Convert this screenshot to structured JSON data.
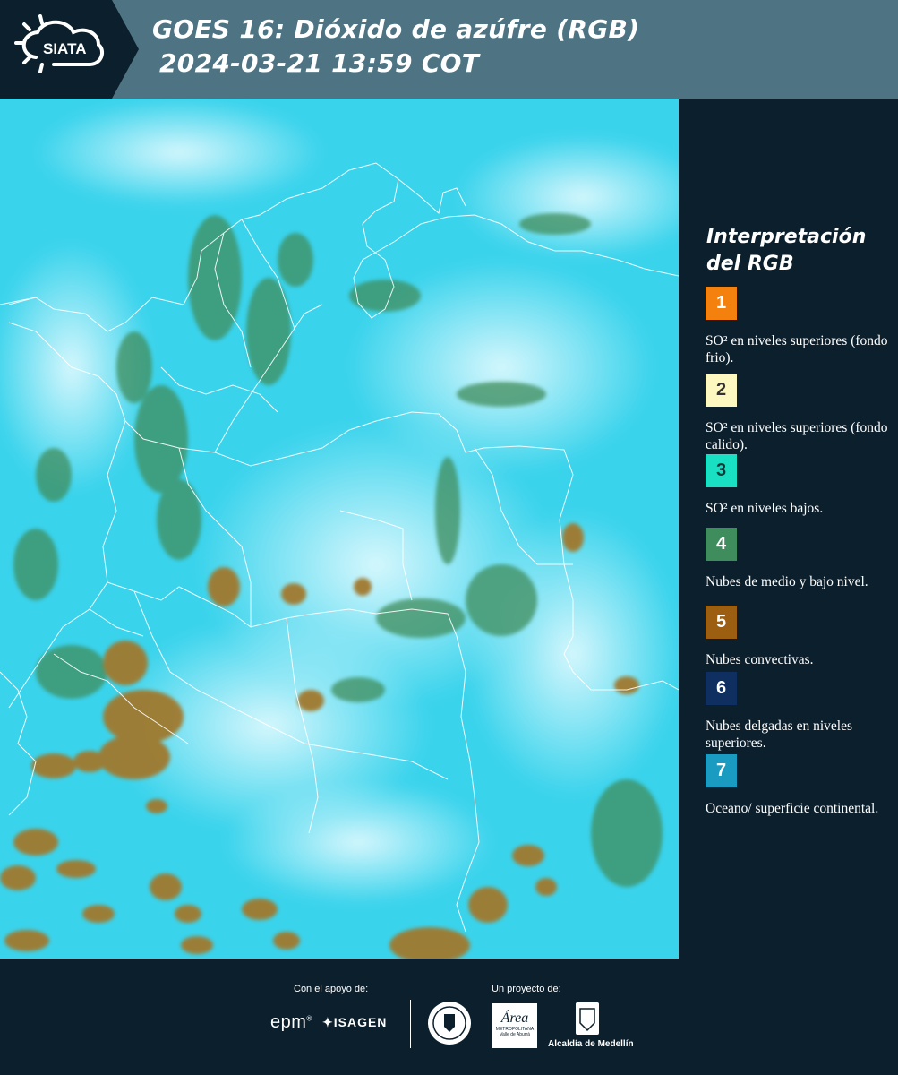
{
  "header": {
    "logo_text": "SIATA",
    "title_line1": "GOES 16: Dióxido de azúfre (RGB)",
    "title_line2": "2024-03-21 13:59 COT"
  },
  "legend": {
    "title_line1": "Interpretación",
    "title_line2": "del RGB",
    "items": [
      {
        "num": "1",
        "color": "#f4800e",
        "text_color": "#ffffff",
        "text": "SO² en niveles superiores (fondo frio)."
      },
      {
        "num": "2",
        "color": "#fdf7c0",
        "text_color": "#333333",
        "text": "SO² en niveles superiores (fondo calido)."
      },
      {
        "num": "3",
        "color": "#19e0c2",
        "text_color": "#0c3a3a",
        "text": "SO² en niveles bajos."
      },
      {
        "num": "4",
        "color": "#3f8d5c",
        "text_color": "#ffffff",
        "text": "Nubes de medio y bajo nivel."
      },
      {
        "num": "5",
        "color": "#9c5f12",
        "text_color": "#ffffff",
        "text": "Nubes convectivas."
      },
      {
        "num": "6",
        "color": "#0e2f60",
        "text_color": "#ffffff",
        "text": "Nubes delgadas en niveles superiores."
      },
      {
        "num": "7",
        "color": "#1a9cc2",
        "text_color": "#ffffff",
        "text": "Oceano/ superficie continental."
      }
    ]
  },
  "footer": {
    "support_label": "Con el apoyo de:",
    "project_label": "Un proyecto de:",
    "sponsor_epm": "epm",
    "sponsor_isagen": "ISAGEN",
    "partner_metro_line1": "Área",
    "partner_metro_line2": "METROPOLITANA",
    "partner_metro_line3": "Valle de Aburrá",
    "partner_alcaldia": "Alcaldía de Medellín"
  }
}
